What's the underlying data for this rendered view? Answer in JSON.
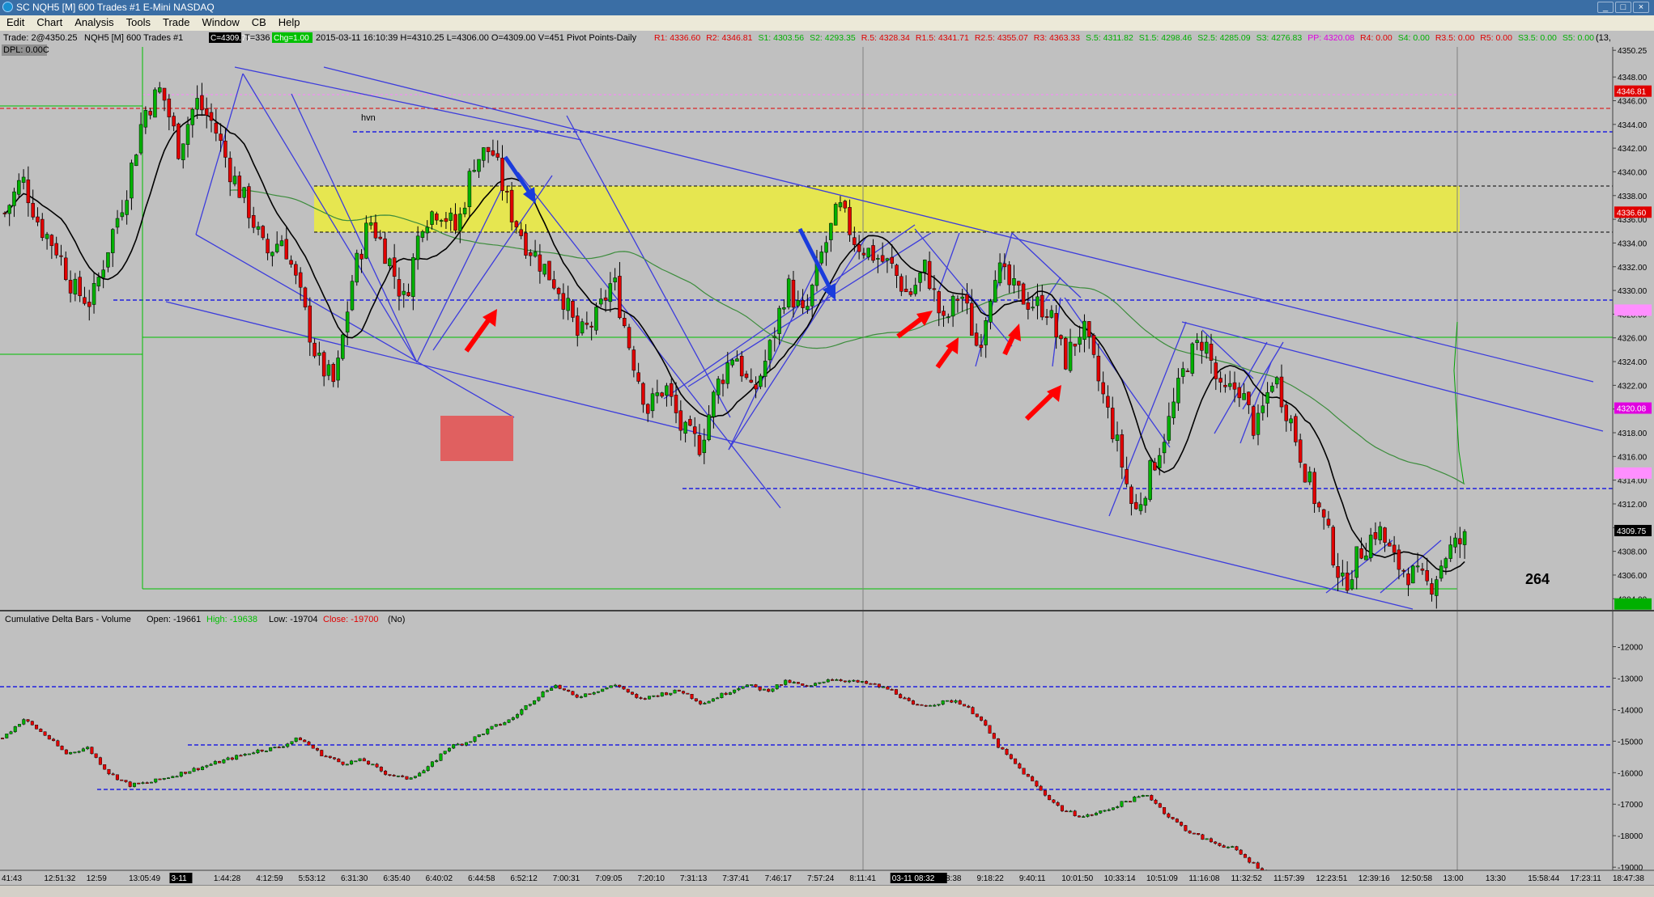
{
  "window": {
    "title": "SC NQH5 [M]  600 Trades  #1  E-Mini NASDAQ",
    "icon": "sierra-chart-icon",
    "controls": [
      "minimize-icon",
      "maximize-icon",
      "close-icon"
    ]
  },
  "menu": [
    "Edit",
    "Chart",
    "Analysis",
    "Tools",
    "Trade",
    "Window",
    "CB",
    "Help"
  ],
  "header": {
    "trade": "Trade: 2@4350.25",
    "symbol": "NQH5 [M]  600 Trades #1",
    "price_box": "C=4309.75",
    "t_val": "T=336",
    "chg_box": "Chg=1.00",
    "ohlc": "2015-03-11 16:10:39 H=4310.25 L=4306.00 O=4309.00 V=451 Pivot Points-Daily",
    "dpl": "DPL: 0.00C",
    "top_right": "(13,",
    "pivots": [
      {
        "text": "R1: 4336.60",
        "color": "#e00000"
      },
      {
        "text": "R2: 4346.81",
        "color": "#e00000"
      },
      {
        "text": "S1: 4303.56",
        "color": "#00b000"
      },
      {
        "text": "S2: 4293.35",
        "color": "#00b000"
      },
      {
        "text": "R.5: 4328.34",
        "color": "#e00000"
      },
      {
        "text": "R1.5: 4341.71",
        "color": "#e00000"
      },
      {
        "text": "R2.5: 4355.07",
        "color": "#e00000"
      },
      {
        "text": "R3: 4363.33",
        "color": "#e00000"
      },
      {
        "text": "S.5: 4311.82",
        "color": "#00b000"
      },
      {
        "text": "S1.5: 4298.46",
        "color": "#00b000"
      },
      {
        "text": "S2.5: 4285.09",
        "color": "#00b000"
      },
      {
        "text": "S3: 4276.83",
        "color": "#00b000"
      },
      {
        "text": "PP: 4320.08",
        "color": "#e000e0"
      },
      {
        "text": "R4: 0.00",
        "color": "#e00000"
      },
      {
        "text": "S4: 0.00",
        "color": "#00b000"
      },
      {
        "text": "R3.5: 0.00",
        "color": "#e00000"
      },
      {
        "text": "R5: 0.00",
        "color": "#e00000"
      },
      {
        "text": "S3.5: 0.00",
        "color": "#00b000"
      },
      {
        "text": "S5: 0.00",
        "color": "#00b000"
      }
    ]
  },
  "price_axis": {
    "ticks": [
      "4350.25",
      "4348.00",
      "4346.00",
      "4344.00",
      "4342.00",
      "4340.00",
      "4338.00",
      "4336.00",
      "4334.00",
      "4332.00",
      "4330.00",
      "4328.00",
      "4326.00",
      "4324.00",
      "4322.00",
      "4320.00",
      "4318.00",
      "4316.00",
      "4314.00",
      "4312.00",
      "4310.00",
      "4308.00",
      "4306.00",
      "4304.00"
    ],
    "labels": [
      {
        "text": "4346.81",
        "bg": "#e00000",
        "fg": "#ffffff",
        "price": 4346.81
      },
      {
        "text": "4336.60",
        "bg": "#e00000",
        "fg": "#ffffff",
        "price": 4336.6
      },
      {
        "text": "4328.34",
        "bg": "#ff8fff",
        "fg": "#ff8fff",
        "price": 4328.34
      },
      {
        "text": "4320.08",
        "bg": "#e000e0",
        "fg": "#ffffff",
        "price": 4320.08
      },
      {
        "text": "4311.82",
        "bg": "#ff8fff",
        "fg": "#ff8fff",
        "price": 4314.6
      },
      {
        "text": "4309.75",
        "bg": "#000000",
        "fg": "#ffffff",
        "price": 4309.75
      },
      {
        "text": "4303.56",
        "bg": "#00b000",
        "fg": "#00b000",
        "price": 4303.56
      }
    ],
    "range": [
      4303.2,
      4350.4
    ]
  },
  "annotations": {
    "hvn": "hvn",
    "count": "264"
  },
  "subgraph": {
    "title": "Cumulative Delta Bars - Volume",
    "open": "Open: -19661",
    "high": "High: -19638",
    "low": "Low: -19704",
    "close": "Close: -19700",
    "flag": "(No)",
    "ticks": [
      "-12000",
      "-13000",
      "-14000",
      "-15000",
      "-16000",
      "-17000",
      "-18000",
      "-19000"
    ],
    "range": [
      -19150,
      -11500
    ]
  },
  "time_axis": {
    "labels": [
      "41:43",
      "12:51:32",
      "12:59",
      "13:05:49",
      "3-11",
      "1:44:28",
      "4:12:59",
      "5:53:12",
      "6:31:30",
      "6:35:40",
      "6:40:02",
      "6:44:58",
      "6:52:12",
      "7:00:31",
      "7:09:05",
      "7:20:10",
      "7:31:13",
      "7:37:41",
      "7:46:17",
      "7:57:24",
      "8:11:41",
      "03-11 08:32",
      "8:58:38",
      "9:18:22",
      "9:40:11",
      "10:01:50",
      "10:33:14",
      "10:51:09",
      "11:16:08",
      "11:32:52",
      "11:57:39",
      "12:23:51",
      "12:39:16",
      "12:50:58",
      "13:00",
      "13:30",
      "15:58:44",
      "17:23:11",
      "18:47:38"
    ]
  },
  "colors": {
    "background": "#c0c0c0",
    "up_candle": "#00b000",
    "down_candle": "#e00000",
    "trendline": "#3c3cdc",
    "highlight": "#e6e650",
    "red_box": "#e06060",
    "arrow_red": "#ff0000",
    "arrow_blue": "#1a3cdc"
  },
  "price_path": [
    4336.5,
    4339.5,
    4335.5,
    4333.5,
    4330,
    4329,
    4334,
    4338.5,
    4345,
    4347,
    4342,
    4346,
    4344,
    4340,
    4337,
    4333,
    4334.5,
    4329.5,
    4324,
    4322,
    4331,
    4336,
    4333,
    4329,
    4336,
    4337,
    4335,
    4341,
    4342,
    4337,
    4334,
    4332,
    4330,
    4326,
    4327.5,
    4331,
    4325,
    4320,
    4322,
    4318,
    4317,
    4322,
    4325,
    4321,
    4325,
    4330.5,
    4327.5,
    4333,
    4337,
    4334,
    4333,
    4332,
    4329.5,
    4332,
    4327,
    4330,
    4325,
    4332,
    4330,
    4329,
    4328.5,
    4324,
    4327,
    4322,
    4317,
    4311,
    4315,
    4319,
    4324,
    4326,
    4321,
    4322,
    4318,
    4323,
    4319,
    4314,
    4310,
    4305,
    4308,
    4310,
    4307,
    4306,
    4305,
    4308,
    4309
  ],
  "delta_path": [
    -14900,
    -14300,
    -14800,
    -15400,
    -15200,
    -16000,
    -16400,
    -16300,
    -16100,
    -15900,
    -15700,
    -15500,
    -15300,
    -15200,
    -14900,
    -15400,
    -15700,
    -15600,
    -16000,
    -16200,
    -15900,
    -15200,
    -15000,
    -14600,
    -14300,
    -13700,
    -13200,
    -13600,
    -13400,
    -13200,
    -13700,
    -13500,
    -13400,
    -13800,
    -13500,
    -13200,
    -13400,
    -13100,
    -13300,
    -13000,
    -13100,
    -13200,
    -13400,
    -13900,
    -13800,
    -13700,
    -14200,
    -15200,
    -15900,
    -16600,
    -17200,
    -17400,
    -17200,
    -16900,
    -16700,
    -17400,
    -17900,
    -18200,
    -18400,
    -18900,
    -19300
  ]
}
